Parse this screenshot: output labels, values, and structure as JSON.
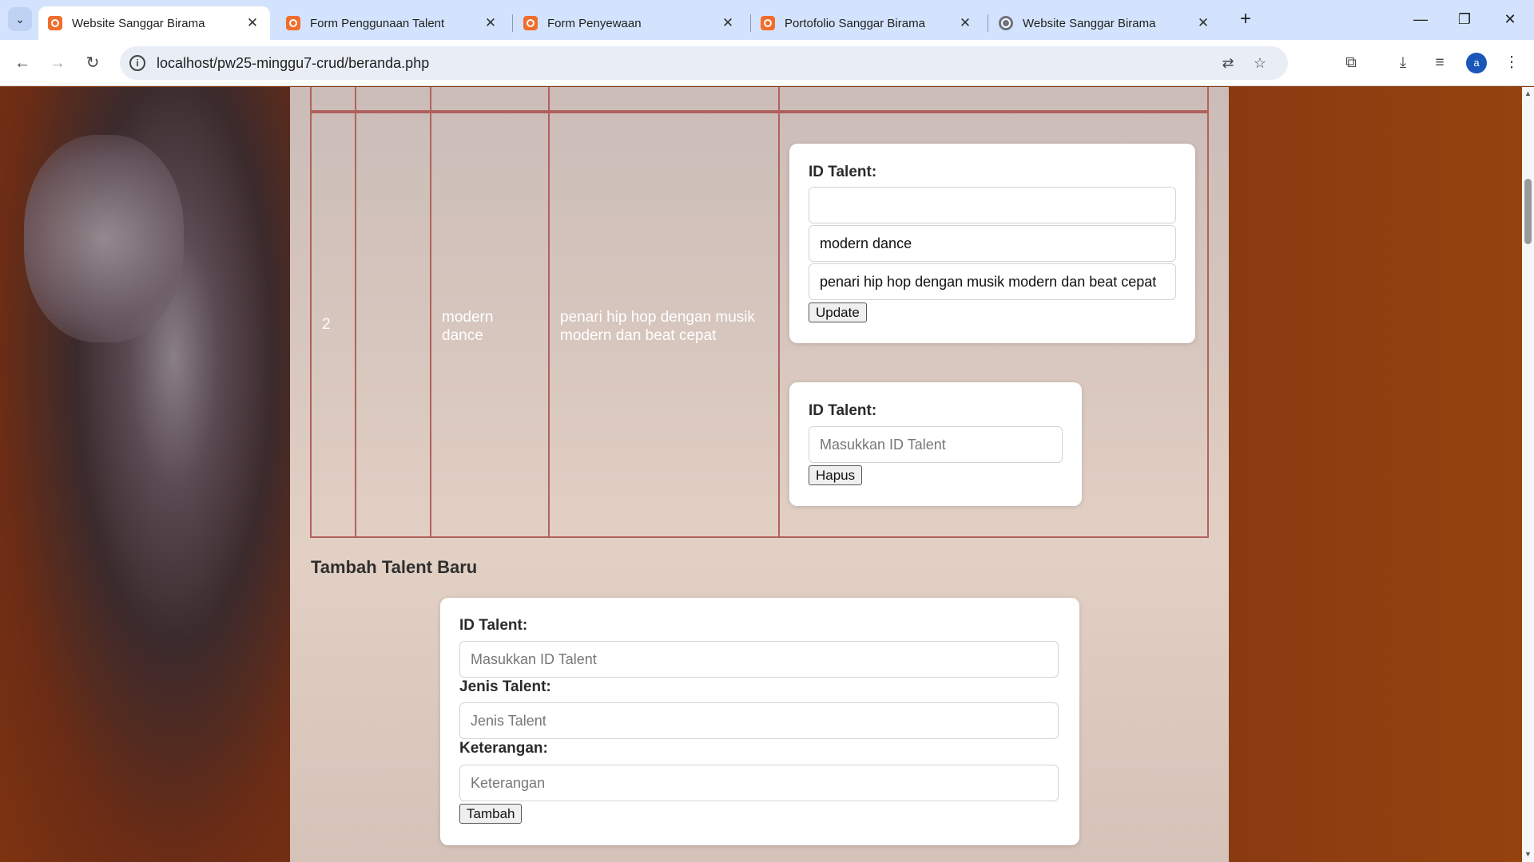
{
  "browser": {
    "tabs": [
      {
        "title": "Website Sanggar Birama",
        "active": true,
        "icon": "xampp-icon"
      },
      {
        "title": "Form Penggunaan Talent",
        "active": false,
        "icon": "xampp-icon"
      },
      {
        "title": "Form Penyewaan",
        "active": false,
        "icon": "xampp-icon"
      },
      {
        "title": "Portofolio Sanggar Birama",
        "active": false,
        "icon": "xampp-icon"
      },
      {
        "title": "Website Sanggar Birama",
        "active": false,
        "icon": "globe-icon"
      }
    ],
    "url": "localhost/pw25-minggu7-crud/beranda.php",
    "profile_initial": "a"
  },
  "table": {
    "row": {
      "no": "2",
      "jenis": "modern dance",
      "keterangan": "penari hip hop dengan musik modern dan beat cepat"
    }
  },
  "update_form": {
    "label_id": "ID Talent:",
    "id_value": "",
    "jenis_value": "modern dance",
    "keterangan_value": "penari hip hop dengan musik modern dan beat cepat",
    "button": "Update"
  },
  "delete_form": {
    "label_id": "ID Talent:",
    "placeholder": "Masukkan ID Talent",
    "button": "Hapus"
  },
  "add_section": {
    "title": "Tambah Talent Baru",
    "label_id": "ID Talent:",
    "placeholder_id": "Masukkan ID Talent",
    "label_jenis": "Jenis Talent:",
    "placeholder_jenis": "Jenis Talent",
    "label_keterangan": "Keterangan:",
    "placeholder_keterangan": "Keterangan",
    "button": "Tambah"
  },
  "colors": {
    "table_border": "#b0615d",
    "page_side": "#8b3a12",
    "tabstrip": "#d3e3fd"
  }
}
